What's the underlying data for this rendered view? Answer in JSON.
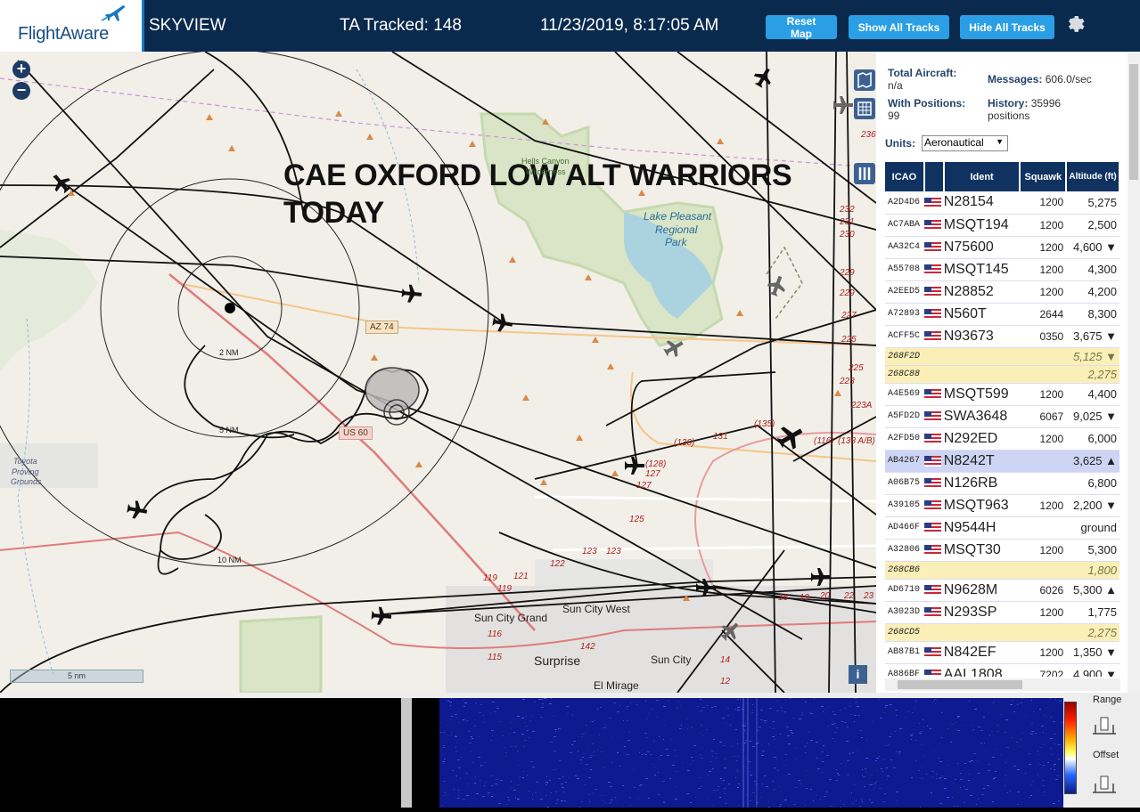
{
  "header": {
    "logo_text": "FlightAware",
    "app_name": "SKYVIEW",
    "ta_tracked": "TA Tracked: 148",
    "clock": "11/23/2019, 8:17:05 AM",
    "buttons": {
      "reset": "Reset Map",
      "show_all": "Show All Tracks",
      "hide_all": "Hide All Tracks"
    }
  },
  "map": {
    "overlay_title_line1": "CAE OXFORD LOW ALT WARRIORS",
    "overlay_title_line2": "TODAY",
    "scale_label": "5 nm",
    "range_rings": [
      "2 NM",
      "5 NM",
      "10 NM"
    ],
    "place_labels": {
      "lake": "Lake Pleasant",
      "lake2": "Regional",
      "lake3": "Park",
      "wilderness1": "Hells Canyon",
      "wilderness2": "Wilderness",
      "toyota1": "Toyota",
      "toyota2": "Proving",
      "toyota3": "Grounds",
      "sun_city_grand": "Sun City Grand",
      "sun_city_west": "Sun City West",
      "surprise": "Surprise",
      "sun_city": "Sun City",
      "el_mirage": "El Mirage"
    },
    "shields": {
      "az74": "AZ 74",
      "us60": "US 60"
    },
    "route_numbers": [
      "236",
      "232",
      "231",
      "230",
      "229",
      "229",
      "227",
      "225",
      "225",
      "223",
      "223A",
      "(130)",
      "131",
      "(135)",
      "(116)",
      "(138 A/B)",
      "(128)",
      "127",
      "127",
      "125",
      "123",
      "123",
      "122",
      "121",
      "119",
      "119",
      "116",
      "115",
      "142",
      "18",
      "19",
      "20",
      "22",
      "23",
      "14",
      "12"
    ]
  },
  "sidebar": {
    "total_aircraft_label": "Total Aircraft:",
    "total_aircraft_value": "n/a",
    "with_positions_label": "With Positions:",
    "with_positions_value": "99",
    "messages_label": "Messages:",
    "messages_value": "606.0/sec",
    "history_label": "History:",
    "history_value": "35996",
    "history_unit": "positions",
    "units_label": "Units:",
    "units_selected": "Aeronautical",
    "columns": [
      "ICAO",
      "",
      "Ident",
      "Squawk",
      "Altitude (ft)"
    ],
    "rows": [
      {
        "icao": "A2D4D6",
        "ident": "N28154",
        "squawk": "1200",
        "alt": "5,275",
        "flag": true
      },
      {
        "icao": "AC7ABA",
        "ident": "MSQT194",
        "squawk": "1200",
        "alt": "2,500",
        "flag": true
      },
      {
        "icao": "AA32C4",
        "ident": "N75600",
        "squawk": "1200",
        "alt": "4,600 ▼",
        "flag": true
      },
      {
        "icao": "A55708",
        "ident": "MSQT145",
        "squawk": "1200",
        "alt": "4,300",
        "flag": true
      },
      {
        "icao": "A2EED5",
        "ident": "N28852",
        "squawk": "1200",
        "alt": "4,200",
        "flag": true
      },
      {
        "icao": "A72893",
        "ident": "N560T",
        "squawk": "2644",
        "alt": "8,300",
        "flag": true
      },
      {
        "icao": "ACFF5C",
        "ident": "N93673",
        "squawk": "0350",
        "alt": "3,675 ▼",
        "flag": true
      },
      {
        "icao": "268F2D",
        "ident": "",
        "squawk": "",
        "alt": "5,125 ▼",
        "flag": false,
        "noid": true
      },
      {
        "icao": "268C88",
        "ident": "",
        "squawk": "",
        "alt": "2,275",
        "flag": false,
        "noid": true
      },
      {
        "icao": "A4E569",
        "ident": "MSQT599",
        "squawk": "1200",
        "alt": "4,400",
        "flag": true
      },
      {
        "icao": "A5FD2D",
        "ident": "SWA3648",
        "squawk": "6067",
        "alt": "9,025 ▼",
        "flag": true
      },
      {
        "icao": "A2FD50",
        "ident": "N292ED",
        "squawk": "1200",
        "alt": "6,000",
        "flag": true
      },
      {
        "icao": "AB4267",
        "ident": "N8242T",
        "squawk": "",
        "alt": "3,625 ▲",
        "flag": true,
        "selected": true
      },
      {
        "icao": "A06B75",
        "ident": "N126RB",
        "squawk": "",
        "alt": "6,800",
        "flag": true
      },
      {
        "icao": "A39105",
        "ident": "MSQT963",
        "squawk": "1200",
        "alt": "2,200 ▼",
        "flag": true
      },
      {
        "icao": "AD466F",
        "ident": "N9544H",
        "squawk": "",
        "alt": "ground",
        "flag": true
      },
      {
        "icao": "A32806",
        "ident": "MSQT30",
        "squawk": "1200",
        "alt": "5,300",
        "flag": true
      },
      {
        "icao": "268CB6",
        "ident": "",
        "squawk": "",
        "alt": "1,800",
        "flag": false,
        "noid": true
      },
      {
        "icao": "AD6710",
        "ident": "N9628M",
        "squawk": "6026",
        "alt": "5,300 ▲",
        "flag": true
      },
      {
        "icao": "A3023D",
        "ident": "N293SP",
        "squawk": "1200",
        "alt": "1,775",
        "flag": true
      },
      {
        "icao": "268CD5",
        "ident": "",
        "squawk": "",
        "alt": "2,275",
        "flag": false,
        "noid": true
      },
      {
        "icao": "AB87B1",
        "ident": "N842EF",
        "squawk": "1200",
        "alt": "1,350 ▼",
        "flag": true
      },
      {
        "icao": "A886BF",
        "ident": "AAL1808",
        "squawk": "7202",
        "alt": "4,900 ▼",
        "flag": true
      }
    ]
  },
  "bottom": {
    "range_label": "Range",
    "offset_label": "Offset"
  },
  "colors": {
    "header_bg": "#0a2a4d",
    "button_bg": "#2b9fe5",
    "table_header": "#0f3260",
    "noid_row": "#fbefb8",
    "selected_row": "#cdd4f4",
    "waterfall": "#0e1a8f"
  },
  "icons": [
    "plane-logo-icon",
    "gear-icon",
    "zoom-in-icon",
    "zoom-out-icon",
    "map-layers-icon",
    "grid-icon",
    "columns-icon",
    "info-icon",
    "aircraft-icon",
    "flag-us-icon"
  ]
}
